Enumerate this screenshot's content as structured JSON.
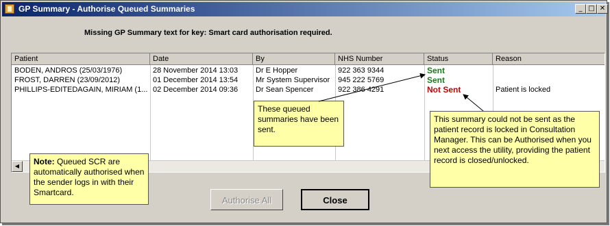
{
  "window": {
    "title": "GP Summary - Authorise Queued Summaries",
    "controls": {
      "minimize": "_",
      "maximize": "□",
      "close": "✕"
    }
  },
  "message": "Missing GP Summary text for key: Smart card authorisation required.",
  "table": {
    "headers": [
      "Patient",
      "Date",
      "By",
      "NHS Number",
      "Status",
      "Reason"
    ],
    "rows": [
      {
        "patient": "BODEN, ANDROS (25/03/1976)",
        "date": "28 November 2014 13:03",
        "by": "Dr E Hopper",
        "nhs": "922 363 9344",
        "status": "Sent",
        "reason": ""
      },
      {
        "patient": "FROST, DARREN (23/09/2012)",
        "date": "01 December 2014 13:54",
        "by": "Mr  System Supervisor",
        "nhs": "945 222 5769",
        "status": "Sent",
        "reason": ""
      },
      {
        "patient": "PHILLIPS-EDITEDAGAIN, MIRIAM (1...",
        "date": "02 December 2014 09:36",
        "by": "Dr Sean Spencer",
        "nhs": "922 386 4291",
        "status": "Not Sent",
        "reason": "Patient is locked"
      }
    ]
  },
  "callouts": {
    "sent": "These queued summaries have been sent.",
    "not_sent": "This summary could not be sent as the patient record is locked in Consultation Manager. This can be Authorised when you next access the utility, providing the patient record is closed/unlocked.",
    "note_label": "Note:",
    "note_text": " Queued SCR are automatically authorised when the sender logs in with their Smartcard."
  },
  "buttons": {
    "authorise_all": "Authorise All",
    "close": "Close"
  },
  "colors": {
    "sent": "#1a7a1a",
    "not_sent": "#cc0000",
    "callout_bg": "#ffffa8"
  }
}
